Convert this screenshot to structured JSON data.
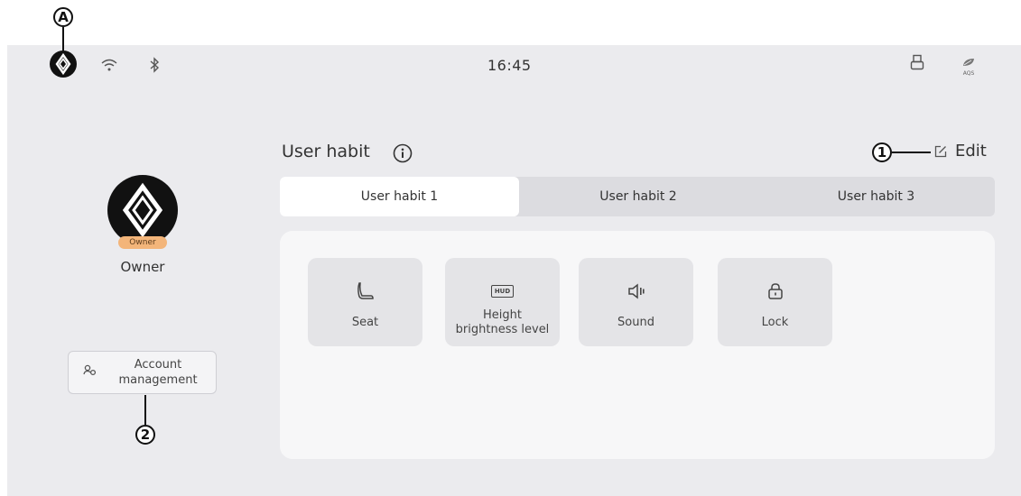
{
  "callouts": {
    "a": "A",
    "one": "1",
    "two": "2"
  },
  "status_bar": {
    "time": "16:45",
    "icons": [
      "brand-logo-icon",
      "wifi-icon",
      "bluetooth-icon",
      "usb-icon",
      "aqs-leaf-icon"
    ],
    "aqs_label": "AQS"
  },
  "profile": {
    "badge": "Owner",
    "name": "Owner",
    "account_button": "Account management"
  },
  "main": {
    "title": "User habit",
    "edit_label": "Edit",
    "tabs": [
      {
        "label": "User habit 1",
        "active": true
      },
      {
        "label": "User habit 2",
        "active": false
      },
      {
        "label": "User habit 3",
        "active": false
      }
    ],
    "tiles": [
      {
        "label": "Seat",
        "icon": "seat-icon"
      },
      {
        "label": "Height brightness level",
        "icon": "hud-icon",
        "icon_text": "HUD"
      },
      {
        "label": "Sound",
        "icon": "speaker-icon"
      },
      {
        "label": "Lock",
        "icon": "lock-icon"
      }
    ]
  }
}
